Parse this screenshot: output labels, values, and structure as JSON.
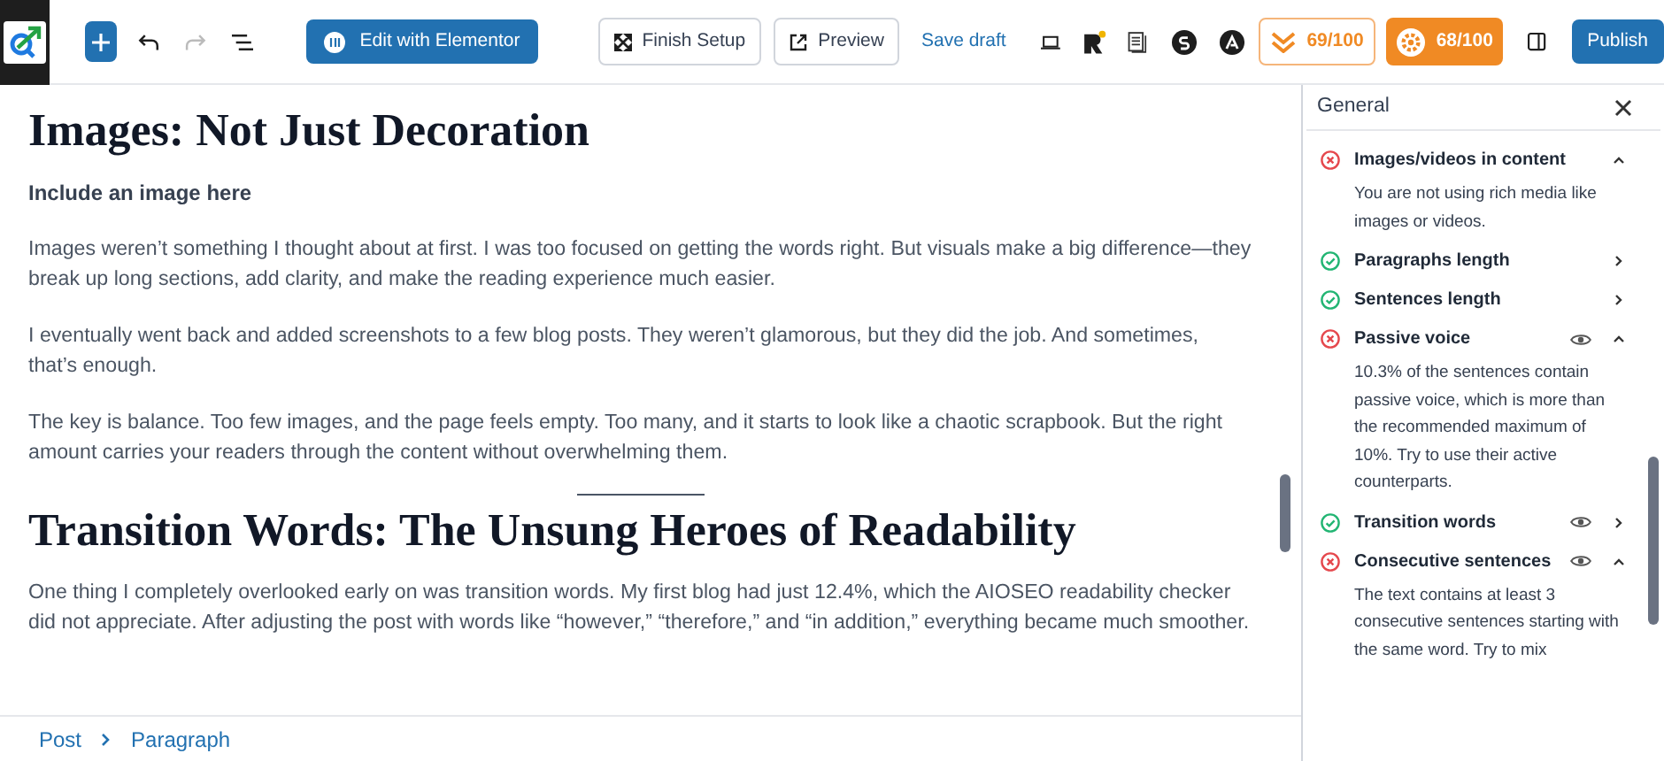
{
  "toolbar": {
    "edit_button": "Edit with Elementor",
    "finish_setup": "Finish Setup",
    "preview": "Preview",
    "save_draft": "Save draft",
    "redo": {
      "disabled": true
    },
    "score_badges": [
      {
        "label": "69/100",
        "kind": "outline"
      },
      {
        "label": "68/100",
        "kind": "filled"
      }
    ],
    "publish": "Publish"
  },
  "content": [
    {
      "kind": "heading",
      "text": "Images: Not Just Decoration"
    },
    {
      "kind": "note",
      "text": "Include an image here"
    },
    {
      "kind": "paragraph",
      "text": "Images weren’t something I thought about at first. I was too focused on getting the words right. But visuals make a big difference—they break up long sections, add clarity, and make the reading experience much easier."
    },
    {
      "kind": "paragraph",
      "text": "I eventually went back and added screenshots to a few blog posts. They weren’t glamorous, but they did the job. And sometimes, that’s enough."
    },
    {
      "kind": "paragraph",
      "text": "The key is balance. Too few images, and the page feels empty. Too many, and it starts to look like a chaotic scrapbook. But the right amount carries your readers through the content without overwhelming them."
    },
    {
      "kind": "separator"
    },
    {
      "kind": "heading",
      "text": "Transition Words: The Unsung Heroes of Readability"
    },
    {
      "kind": "paragraph",
      "text": "One thing I completely overlooked early on was transition words. My first blog had just 12.4%, which the AIOSEO readability checker did not appreciate. After adjusting the post with words like “however,” “therefore,” and “in addition,” everything became much smoother."
    }
  ],
  "sidebar": {
    "title": "General",
    "checks": [
      {
        "label": "Images/videos in content",
        "passed": false,
        "highlight": false,
        "expanded": true,
        "description": "You are not using rich media like images or videos."
      },
      {
        "label": "Paragraphs length",
        "passed": true,
        "highlight": false,
        "expanded": false
      },
      {
        "label": "Sentences length",
        "passed": true,
        "highlight": false,
        "expanded": false
      },
      {
        "label": "Passive voice",
        "passed": false,
        "highlight": true,
        "expanded": true,
        "description": "10.3% of the sentences contain passive voice, which is more than the recommended maximum of 10%. Try to use their active counterparts."
      },
      {
        "label": "Transition words",
        "passed": true,
        "highlight": true,
        "expanded": false
      },
      {
        "label": "Consecutive sentences",
        "passed": false,
        "highlight": true,
        "expanded": true,
        "description": "The text contains at least 3 consecutive sentences starting with the same word. Try to mix"
      }
    ]
  },
  "breadcrumb": [
    "Post",
    "Paragraph"
  ]
}
